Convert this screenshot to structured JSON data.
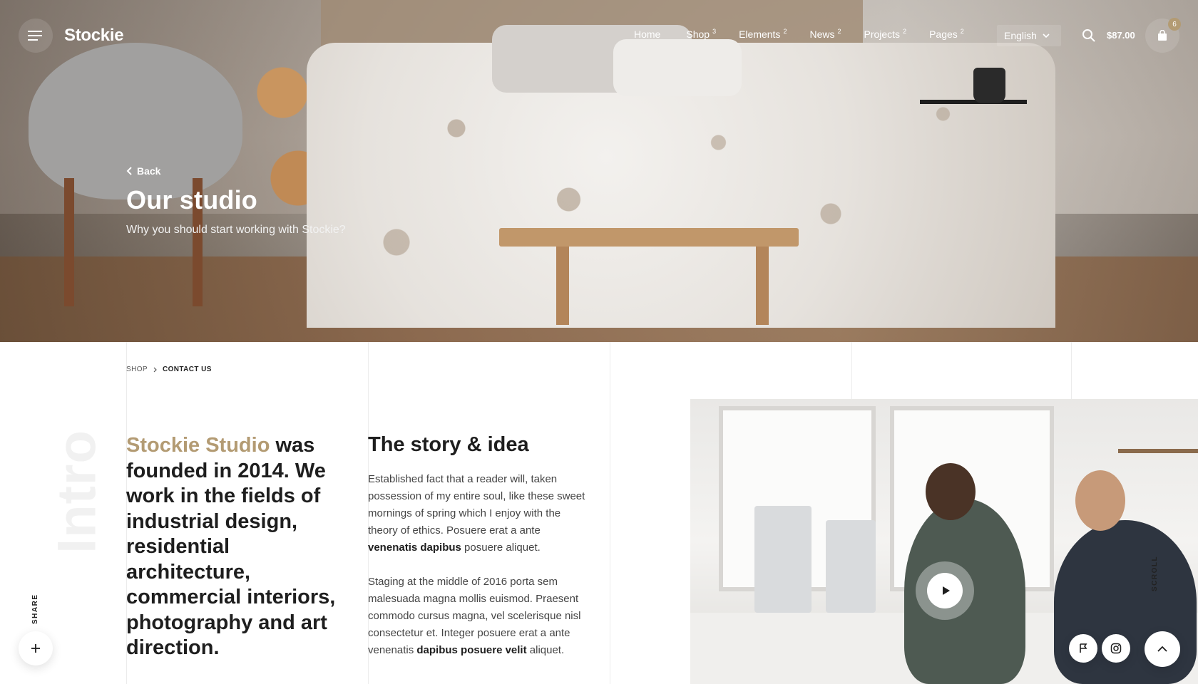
{
  "header": {
    "logo": "Stockie",
    "nav": [
      {
        "label": "Home",
        "count": ""
      },
      {
        "label": "Shop",
        "count": "3"
      },
      {
        "label": "Elements",
        "count": "2"
      },
      {
        "label": "News",
        "count": "2"
      },
      {
        "label": "Projects",
        "count": "2"
      },
      {
        "label": "Pages",
        "count": "2"
      }
    ],
    "language": "English",
    "cart_total": "$87.00",
    "cart_count": "6"
  },
  "hero": {
    "back_label": "Back",
    "title": "Our studio",
    "subtitle": "Why you should start working with Stockie?"
  },
  "breadcrumb": {
    "items": [
      "SHOP",
      "CONTACT US"
    ]
  },
  "intro": {
    "vertical_label": "Intro",
    "lead_accent": "Stockie Studio",
    "lead_rest": " was founded in 2014. We work in the fields of industrial design, residential architecture, commercial interiors, photography and art direction."
  },
  "story": {
    "title": "The story & idea",
    "p1_text": "Established fact that a reader will, taken possession of my entire soul, like these sweet mornings of spring which I enjoy with the theory of ethics. Posuere erat a ante ",
    "p1_bold": "venenatis dapibus",
    "p1_end": " posuere aliquet.",
    "p2_text": "Staging at the middle of 2016 porta sem malesuada magna mollis euismod. Praesent commodo cursus magna, vel scelerisque nisl consectetur et. Integer posuere erat a ante venenatis ",
    "p2_bold": "dapibus posuere velit",
    "p2_end": " aliquet."
  },
  "floating": {
    "share_label": "SHARE",
    "scroll_label": "SCROLL"
  },
  "icons": {
    "menu": "menu-icon",
    "search": "search-icon",
    "cart": "shopping-bag-icon",
    "chevron_down": "chevron-down-icon",
    "chevron_left": "chevron-left-icon",
    "chevron_right": "chevron-right-icon",
    "play": "play-icon",
    "plus": "plus-icon",
    "flag": "flag-icon",
    "instagram": "instagram-icon",
    "arrow_up": "chevron-up-icon"
  },
  "colors": {
    "accent": "#b39b73",
    "text_dark": "#1e1e1e"
  }
}
